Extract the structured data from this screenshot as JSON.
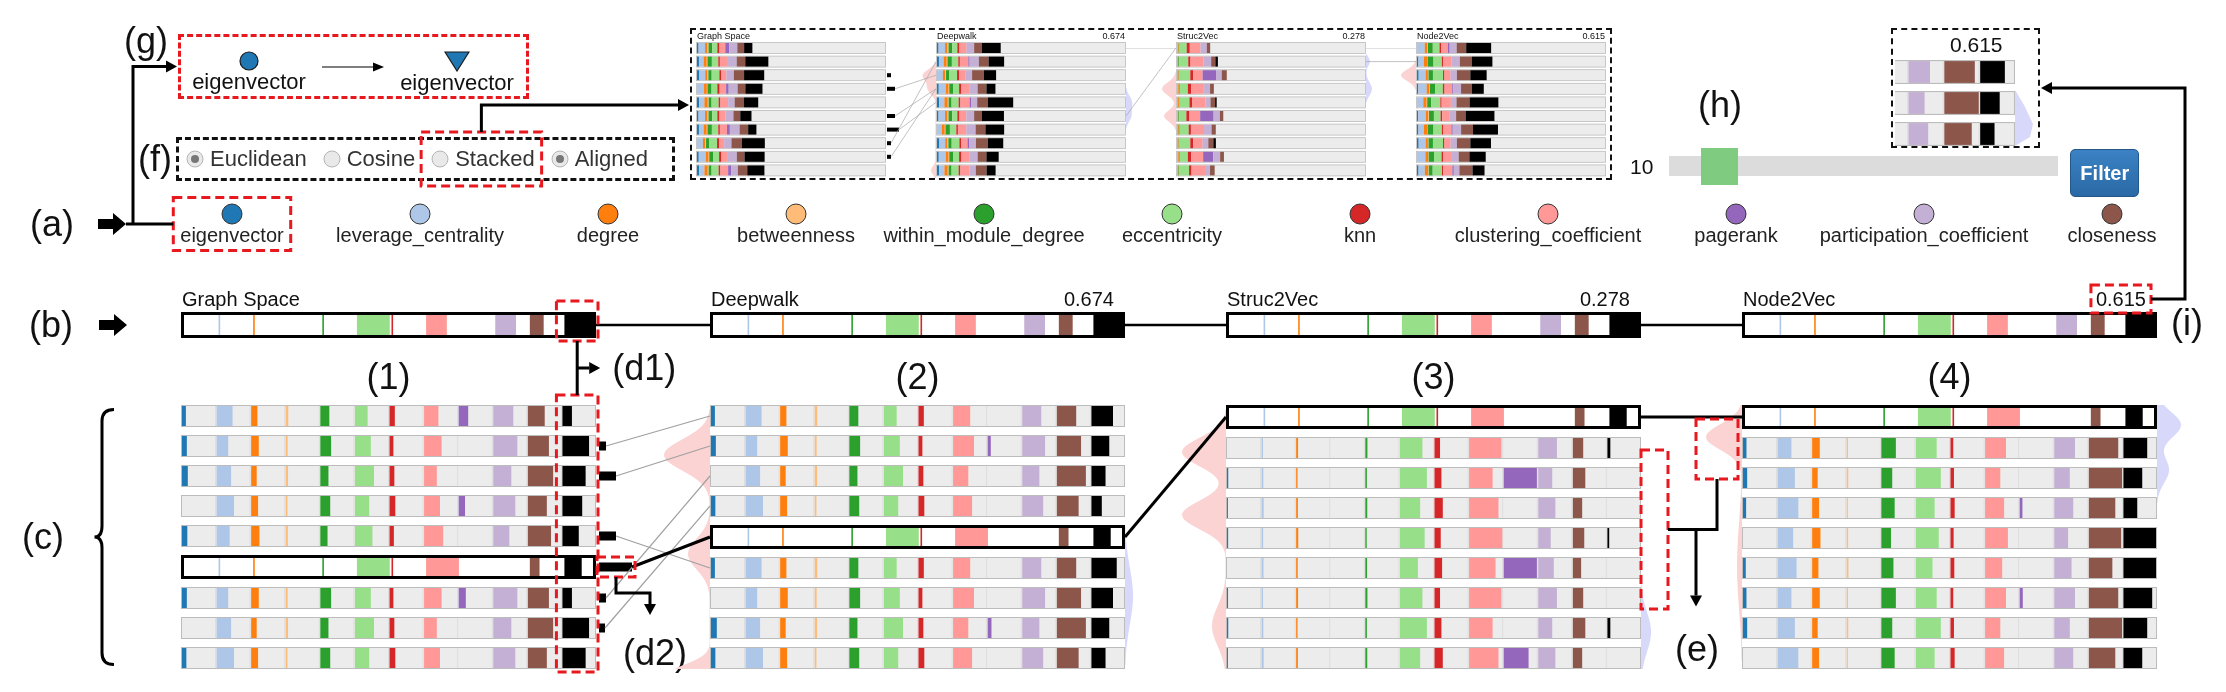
{
  "glyph_change": {
    "callout": "(g)",
    "from": "eigenvector",
    "to": "eigenvector"
  },
  "options": {
    "callout": "(f)",
    "items": [
      {
        "label": "Euclidean",
        "selected": true,
        "annotated": false
      },
      {
        "label": "Cosine",
        "selected": false,
        "annotated": false
      },
      {
        "label": "Stacked",
        "selected": false,
        "annotated": true
      },
      {
        "label": "Aligned",
        "selected": true,
        "annotated": false
      }
    ]
  },
  "overview": {
    "panels": [
      {
        "title": "Graph Space"
      },
      {
        "title": "Deepwalk",
        "score": "0.674"
      },
      {
        "title": "Struc2Vec",
        "score": "0.278"
      },
      {
        "title": "Node2Vec",
        "score": "0.615"
      }
    ]
  },
  "slider": {
    "callout": "(h)",
    "label": "10",
    "level": 0.09
  },
  "filter_button": "Filter",
  "detail": {
    "score": "0.615"
  },
  "legend": {
    "callout": "(a)",
    "items": [
      {
        "name": "eigenvector",
        "color": "#1f77b4",
        "annotated": true
      },
      {
        "name": "leverage_centrality",
        "color": "#aec7e8",
        "annotated": false
      },
      {
        "name": "degree",
        "color": "#ff7f0e",
        "annotated": false
      },
      {
        "name": "betweenness",
        "color": "#ffbb78",
        "annotated": false
      },
      {
        "name": "within_module_degree",
        "color": "#2ca02c",
        "annotated": false
      },
      {
        "name": "eccentricity",
        "color": "#98df8a",
        "annotated": false
      },
      {
        "name": "knn",
        "color": "#d62728",
        "annotated": false
      },
      {
        "name": "clustering_coefficient",
        "color": "#ff9896",
        "annotated": false
      },
      {
        "name": "pagerank",
        "color": "#9467bd",
        "annotated": false
      },
      {
        "name": "participation_coefficient",
        "color": "#c5b0d5",
        "annotated": false
      },
      {
        "name": "closeness",
        "color": "#8c564b",
        "annotated": false
      }
    ]
  },
  "summary_callout": "(b)",
  "rows_callout": "(c)",
  "metric_callout": "(d1)",
  "mark_callout": "(d2)",
  "density_callout": "(e)",
  "score_callout": "(i)",
  "panels": [
    {
      "number": "(1)",
      "title": "Graph Space",
      "annotated": false,
      "rows": [
        {
          "selected": false
        },
        {
          "selected": false
        },
        {
          "selected": false
        },
        {
          "selected": false
        },
        {
          "selected": false
        },
        {
          "selected": true
        },
        {
          "selected": false
        },
        {
          "selected": false
        },
        {
          "selected": false
        }
      ]
    },
    {
      "number": "(2)",
      "title": "Deepwalk",
      "score": "0.674",
      "annotated": false,
      "rows": [
        {
          "selected": false
        },
        {
          "selected": false
        },
        {
          "selected": false
        },
        {
          "selected": false
        },
        {
          "selected": true
        },
        {
          "selected": false
        },
        {
          "selected": false
        },
        {
          "selected": false
        },
        {
          "selected": false
        }
      ]
    },
    {
      "number": "(3)",
      "title": "Struc2Vec",
      "score": "0.278",
      "annotated": false,
      "rows": [
        {
          "selected": true
        },
        {
          "selected": false
        },
        {
          "selected": false
        },
        {
          "selected": false
        },
        {
          "selected": false
        },
        {
          "selected": false
        },
        {
          "selected": false
        },
        {
          "selected": false
        },
        {
          "selected": false
        }
      ]
    },
    {
      "number": "(4)",
      "title": "Node2Vec",
      "score": "0.615",
      "annotated": true,
      "rows": [
        {
          "selected": true
        },
        {
          "selected": false
        },
        {
          "selected": false
        },
        {
          "selected": false
        },
        {
          "selected": false
        },
        {
          "selected": false
        },
        {
          "selected": false
        },
        {
          "selected": false
        },
        {
          "selected": false
        }
      ]
    }
  ]
}
